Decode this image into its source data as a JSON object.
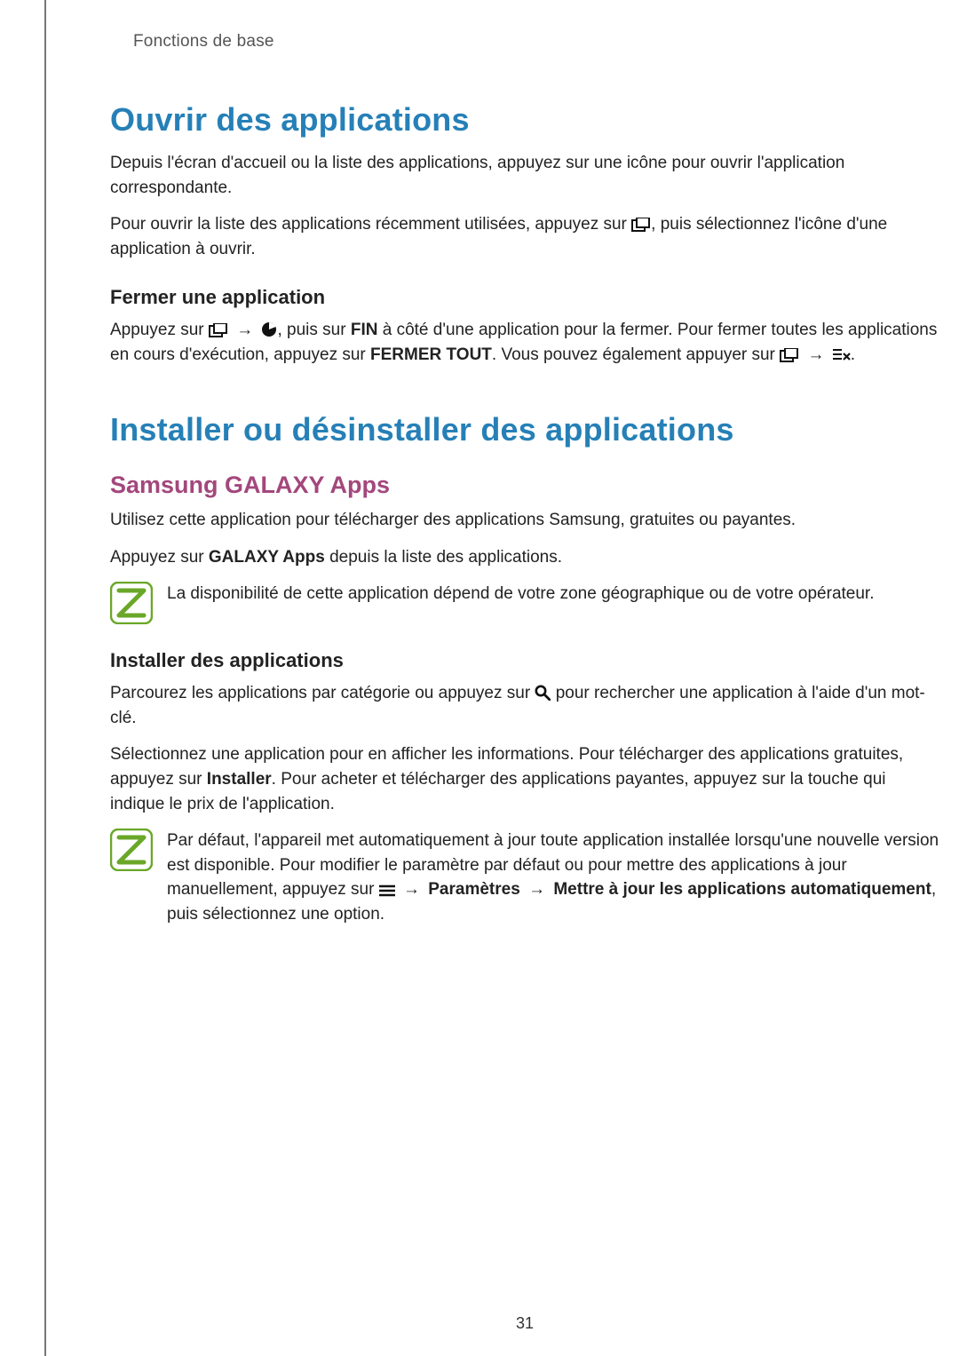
{
  "header": {
    "chapter": "Fonctions de base"
  },
  "section1": {
    "title": "Ouvrir des applications",
    "p1": "Depuis l'écran d'accueil ou la liste des applications, appuyez sur une icône pour ouvrir l'application correspondante.",
    "p2a": "Pour ouvrir la liste des applications récemment utilisées, appuyez sur ",
    "p2b": ", puis sélectionnez l'icône d'une application à ouvrir.",
    "sub": {
      "title": "Fermer une application",
      "p1a": "Appuyez sur ",
      "p1b": ", puis sur ",
      "p1_bold1": "FIN",
      "p1c": " à côté d'une application pour la fermer. Pour fermer toutes les applications en cours d'exécution, appuyez sur ",
      "p1_bold2": "FERMER TOUT",
      "p1d": ". Vous pouvez également appuyer sur ",
      "p1e": "."
    }
  },
  "section2": {
    "title": "Installer ou désinstaller des applications",
    "sub1": {
      "title": "Samsung GALAXY Apps",
      "p1": "Utilisez cette application pour télécharger des applications Samsung, gratuites ou payantes.",
      "p2a": "Appuyez sur ",
      "p2_bold": "GALAXY Apps",
      "p2b": " depuis la liste des applications.",
      "note": "La disponibilité de cette application dépend de votre zone géographique ou de votre opérateur."
    },
    "sub2": {
      "title": "Installer des applications",
      "p1a": "Parcourez les applications par catégorie ou appuyez sur ",
      "p1b": " pour rechercher une application à l'aide d'un mot-clé.",
      "p2a": "Sélectionnez une application pour en afficher les informations. Pour télécharger des applications gratuites, appuyez sur ",
      "p2_bold1": "Installer",
      "p2b": ". Pour acheter et télécharger des applications payantes, appuyez sur la touche qui indique le prix de l'application.",
      "note_a": "Par défaut, l'appareil met automatiquement à jour toute application installée lorsqu'une nouvelle version est disponible. Pour modifier le paramètre par défaut ou pour mettre des applications à jour manuellement, appuyez sur ",
      "note_bold1": "Paramètres",
      "note_bold2": "Mettre à jour les applications automatiquement",
      "note_b": ", puis sélectionnez une option."
    }
  },
  "arrow": "→",
  "pageNumber": "31"
}
